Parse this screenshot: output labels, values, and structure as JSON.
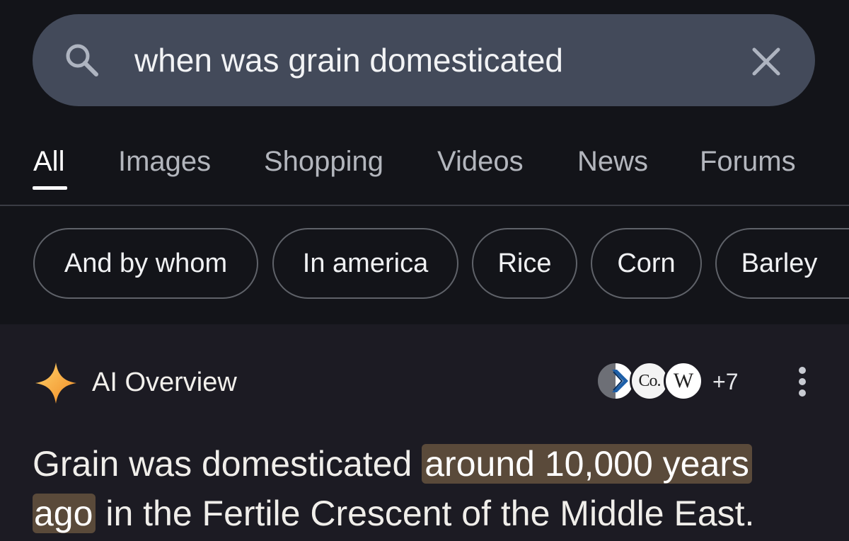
{
  "search": {
    "query": "when was grain domesticated"
  },
  "tabs": [
    {
      "label": "All",
      "active": true
    },
    {
      "label": "Images"
    },
    {
      "label": "Shopping"
    },
    {
      "label": "Videos"
    },
    {
      "label": "News"
    },
    {
      "label": "Forums"
    }
  ],
  "chips": [
    {
      "label": "And by whom"
    },
    {
      "label": "In america"
    },
    {
      "label": "Rice"
    },
    {
      "label": "Corn"
    },
    {
      "label": "Barley"
    }
  ],
  "ai_overview": {
    "title": "AI Overview",
    "sources": [
      {
        "icon": "chevron-logo-icon"
      },
      {
        "text": "Co."
      },
      {
        "text": "W"
      }
    ],
    "more_sources": "+7",
    "answer_before": "Grain was domesticated ",
    "answer_highlight_1": "around 10,000 years",
    "answer_highlight_2": "ago",
    "answer_after": " in the Fertile Crescent of the Middle East."
  },
  "colors": {
    "background": "#13141a",
    "search_bar": "#434a5a",
    "highlight": "#5a4a3a",
    "sparkle": "#f5a623"
  }
}
